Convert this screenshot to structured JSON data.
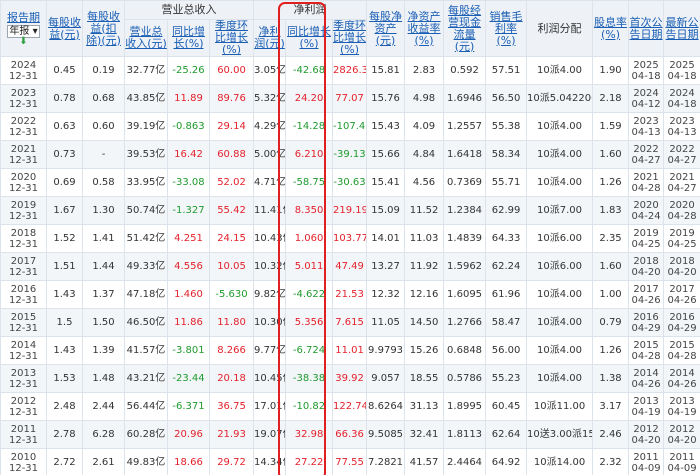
{
  "header": {
    "period": "报告期",
    "period_select": "年报",
    "eps": "每股收益(元)",
    "eps_adj": "每股收益(扣除)(元)",
    "revenue_group": "营业总收入",
    "revenue": "营业总收入(元)",
    "rev_yoy": "同比增长(%)",
    "rev_qoq": "季度环比增长(%)",
    "profit_group": "净利润",
    "profit": "净利润(元)",
    "profit_yoy": "同比增长(%)",
    "profit_qoq": "季度环比增长(%)",
    "bvps": "每股净资产(元)",
    "roe": "净资产收益率(%)",
    "cfps": "每股经营现金流量(元)",
    "gross_margin": "销售毛利率(%)",
    "dividend": "利润分配",
    "yield": "股息率(%)",
    "first_date": "首次公告日期",
    "latest_date": "最新公告日期"
  },
  "rows": [
    {
      "y": "2024",
      "d": "12-31",
      "eps": "0.45",
      "eps_adj": "0.19",
      "rev": "32.77亿",
      "rev_yoy": "-25.26",
      "rev_qoq": "60.00",
      "profit": "3.05亿",
      "p_yoy": "-42.68",
      "p_qoq": "2826.3",
      "bvps": "15.81",
      "roe": "2.83",
      "cfps": "0.592",
      "gm": "57.51",
      "div": "10派4.00",
      "yield": "1.90",
      "f1": "2025",
      "f2": "04-18",
      "l1": "2025",
      "l2": "04-18"
    },
    {
      "y": "2023",
      "d": "12-31",
      "eps": "0.78",
      "eps_adj": "0.68",
      "rev": "43.85亿",
      "rev_yoy": "11.89",
      "rev_qoq": "89.76",
      "profit": "5.32亿",
      "p_yoy": "24.20",
      "p_qoq": "77.07",
      "bvps": "15.76",
      "roe": "4.98",
      "cfps": "1.6946",
      "gm": "56.50",
      "div": "10派5.042206",
      "yield": "2.18",
      "f1": "2024",
      "f2": "04-12",
      "l1": "2024",
      "l2": "04-18"
    },
    {
      "y": "2022",
      "d": "12-31",
      "eps": "0.63",
      "eps_adj": "0.60",
      "rev": "39.19亿",
      "rev_yoy": "-0.863",
      "rev_qoq": "29.14",
      "profit": "4.29亿",
      "p_yoy": "-14.28",
      "p_qoq": "-107.47",
      "bvps": "15.43",
      "roe": "4.09",
      "cfps": "1.2557",
      "gm": "55.38",
      "div": "10派4.00",
      "yield": "1.59",
      "f1": "2023",
      "f2": "04-13",
      "l1": "2023",
      "l2": "04-13"
    },
    {
      "y": "2021",
      "d": "12-31",
      "eps": "0.73",
      "eps_adj": "-",
      "rev": "39.53亿",
      "rev_yoy": "16.42",
      "rev_qoq": "60.88",
      "profit": "5.00亿",
      "p_yoy": "6.210",
      "p_qoq": "-39.13",
      "bvps": "15.66",
      "roe": "4.84",
      "cfps": "1.6418",
      "gm": "58.34",
      "div": "10派4.00",
      "yield": "1.60",
      "f1": "2022",
      "f2": "04-27",
      "l1": "2022",
      "l2": "04-27"
    },
    {
      "y": "2020",
      "d": "12-31",
      "eps": "0.69",
      "eps_adj": "0.58",
      "rev": "33.95亿",
      "rev_yoy": "-33.08",
      "rev_qoq": "52.02",
      "profit": "4.71亿",
      "p_yoy": "-58.75",
      "p_qoq": "-30.63",
      "bvps": "15.41",
      "roe": "4.56",
      "cfps": "0.7369",
      "gm": "55.71",
      "div": "10派4.00",
      "yield": "1.26",
      "f1": "2021",
      "f2": "04-28",
      "l1": "2021",
      "l2": "04-27"
    },
    {
      "y": "2019",
      "d": "12-31",
      "eps": "1.67",
      "eps_adj": "1.30",
      "rev": "50.74亿",
      "rev_yoy": "-1.327",
      "rev_qoq": "55.42",
      "profit": "11.41亿",
      "p_yoy": "8.350",
      "p_qoq": "219.19",
      "bvps": "15.09",
      "roe": "11.52",
      "cfps": "1.2384",
      "gm": "62.99",
      "div": "10派7.00",
      "yield": "1.83",
      "f1": "2020",
      "f2": "04-24",
      "l1": "2020",
      "l2": "04-28"
    },
    {
      "y": "2018",
      "d": "12-31",
      "eps": "1.52",
      "eps_adj": "1.41",
      "rev": "51.42亿",
      "rev_yoy": "4.251",
      "rev_qoq": "24.15",
      "profit": "10.43亿",
      "p_yoy": "1.060",
      "p_qoq": "103.77",
      "bvps": "14.01",
      "roe": "11.03",
      "cfps": "1.4839",
      "gm": "64.33",
      "div": "10派6.00",
      "yield": "2.35",
      "f1": "2019",
      "f2": "04-25",
      "l1": "2019",
      "l2": "04-25"
    },
    {
      "y": "2017",
      "d": "12-31",
      "eps": "1.51",
      "eps_adj": "1.44",
      "rev": "49.33亿",
      "rev_yoy": "4.556",
      "rev_qoq": "10.05",
      "profit": "10.32亿",
      "p_yoy": "5.011",
      "p_qoq": "47.49",
      "bvps": "13.27",
      "roe": "11.92",
      "cfps": "1.5962",
      "gm": "62.24",
      "div": "10派6.00",
      "yield": "1.60",
      "f1": "2018",
      "f2": "04-20",
      "l1": "2018",
      "l2": "04-20"
    },
    {
      "y": "2016",
      "d": "12-31",
      "eps": "1.43",
      "eps_adj": "1.37",
      "rev": "47.18亿",
      "rev_yoy": "1.460",
      "rev_qoq": "-5.630",
      "profit": "9.82亿",
      "p_yoy": "-4.622",
      "p_qoq": "21.53",
      "bvps": "12.32",
      "roe": "12.16",
      "cfps": "1.6095",
      "gm": "61.96",
      "div": "10派4.00",
      "yield": "1.00",
      "f1": "2017",
      "f2": "04-26",
      "l1": "2017",
      "l2": "04-26"
    },
    {
      "y": "2015",
      "d": "12-31",
      "eps": "1.5",
      "eps_adj": "1.50",
      "rev": "46.50亿",
      "rev_yoy": "11.86",
      "rev_qoq": "11.80",
      "profit": "10.30亿",
      "p_yoy": "5.356",
      "p_qoq": "7.615",
      "bvps": "11.05",
      "roe": "14.50",
      "cfps": "1.2766",
      "gm": "58.47",
      "div": "10派4.00",
      "yield": "0.79",
      "f1": "2016",
      "f2": "04-29",
      "l1": "2016",
      "l2": "04-29"
    },
    {
      "y": "2014",
      "d": "12-31",
      "eps": "1.43",
      "eps_adj": "1.39",
      "rev": "41.57亿",
      "rev_yoy": "-3.801",
      "rev_qoq": "8.266",
      "profit": "9.77亿",
      "p_yoy": "-6.724",
      "p_qoq": "11.01",
      "bvps": "9.9793",
      "roe": "15.26",
      "cfps": "0.6848",
      "gm": "56.00",
      "div": "10派4.00",
      "yield": "1.26",
      "f1": "2015",
      "f2": "04-28",
      "l1": "2015",
      "l2": "04-28"
    },
    {
      "y": "2013",
      "d": "12-31",
      "eps": "1.53",
      "eps_adj": "1.48",
      "rev": "43.21亿",
      "rev_yoy": "-23.44",
      "rev_qoq": "20.18",
      "profit": "10.45亿",
      "p_yoy": "-38.38",
      "p_qoq": "39.92",
      "bvps": "9.057",
      "roe": "18.55",
      "cfps": "0.5786",
      "gm": "55.23",
      "div": "10派4.00",
      "yield": "1.38",
      "f1": "2014",
      "f2": "04-26",
      "l1": "2014",
      "l2": "04-26"
    },
    {
      "y": "2012",
      "d": "12-31",
      "eps": "2.48",
      "eps_adj": "2.44",
      "rev": "56.44亿",
      "rev_yoy": "-6.371",
      "rev_qoq": "36.75",
      "profit": "17.01亿",
      "p_yoy": "-10.82",
      "p_qoq": "122.74",
      "bvps": "8.6264",
      "roe": "31.13",
      "cfps": "1.8995",
      "gm": "60.45",
      "div": "10派11.00",
      "yield": "3.17",
      "f1": "2013",
      "f2": "04-19",
      "l1": "2013",
      "l2": "04-19"
    },
    {
      "y": "2011",
      "d": "12-31",
      "eps": "2.78",
      "eps_adj": "6.28",
      "rev": "60.28亿",
      "rev_yoy": "20.96",
      "rev_qoq": "21.93",
      "profit": "19.07亿",
      "p_yoy": "32.98",
      "p_qoq": "66.36",
      "bvps": "9.5085",
      "roe": "32.41",
      "cfps": "1.8113",
      "gm": "62.64",
      "div": "10送3.00派15.20",
      "yield": "2.46",
      "f1": "2012",
      "f2": "04-20",
      "l1": "2012",
      "l2": "04-20"
    },
    {
      "y": "2010",
      "d": "12-31",
      "eps": "2.72",
      "eps_adj": "2.61",
      "rev": "49.83亿",
      "rev_yoy": "18.66",
      "rev_qoq": "29.72",
      "profit": "14.34亿",
      "p_yoy": "27.22",
      "p_qoq": "77.55",
      "bvps": "7.2821",
      "roe": "41.57",
      "cfps": "2.4464",
      "gm": "64.92",
      "div": "10派14.00",
      "yield": "2.32",
      "f1": "2011",
      "f2": "04-09",
      "l1": "2011",
      "l2": "04-09"
    }
  ],
  "colors": {
    "up": "#e4212b",
    "down": "#1f9a2d",
    "header_link": "#1a5fb4",
    "highlight_box": "#e02020"
  }
}
